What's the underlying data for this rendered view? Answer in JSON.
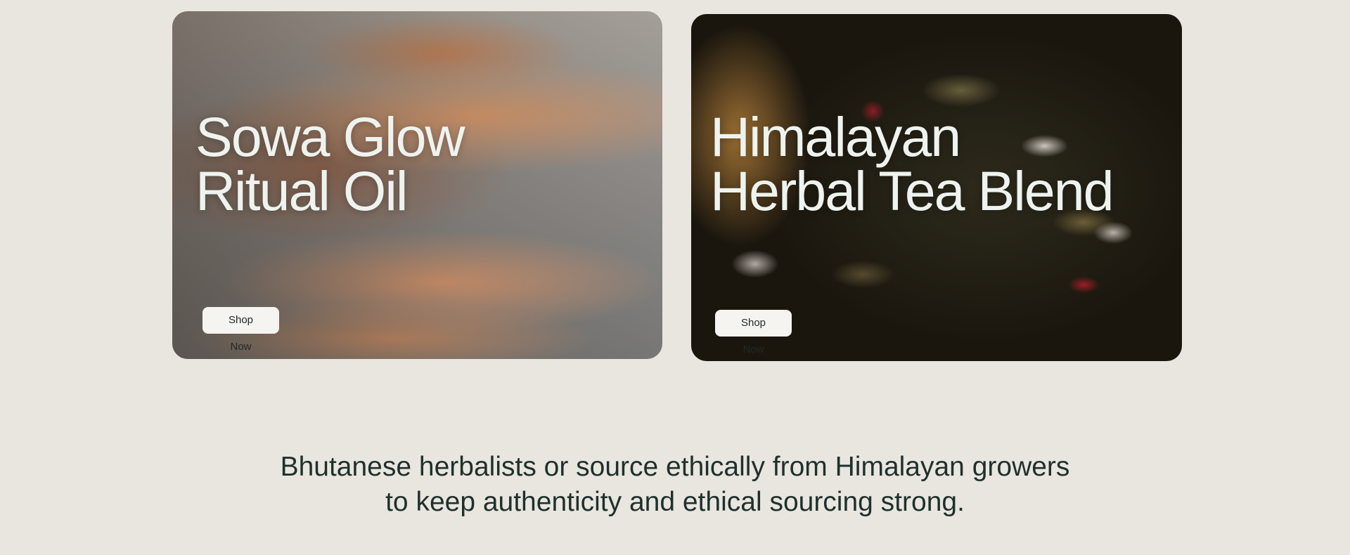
{
  "cards": [
    {
      "title_line1": "Sowa Glow",
      "title_line2": "Ritual Oil",
      "button_label": "Shop Now"
    },
    {
      "title_line1": "Himalayan",
      "title_line2": "Herbal Tea Blend",
      "button_label": "Shop Now"
    }
  ],
  "tagline": {
    "line1": "Bhutanese herbalists or source ethically from Himalayan growers",
    "line2": "to keep authenticity and ethical sourcing strong."
  },
  "colors": {
    "background": "#e9e6df",
    "title_text": "#eef3ef",
    "button_bg": "#f5f4f0",
    "tagline_text": "#1f302d"
  }
}
